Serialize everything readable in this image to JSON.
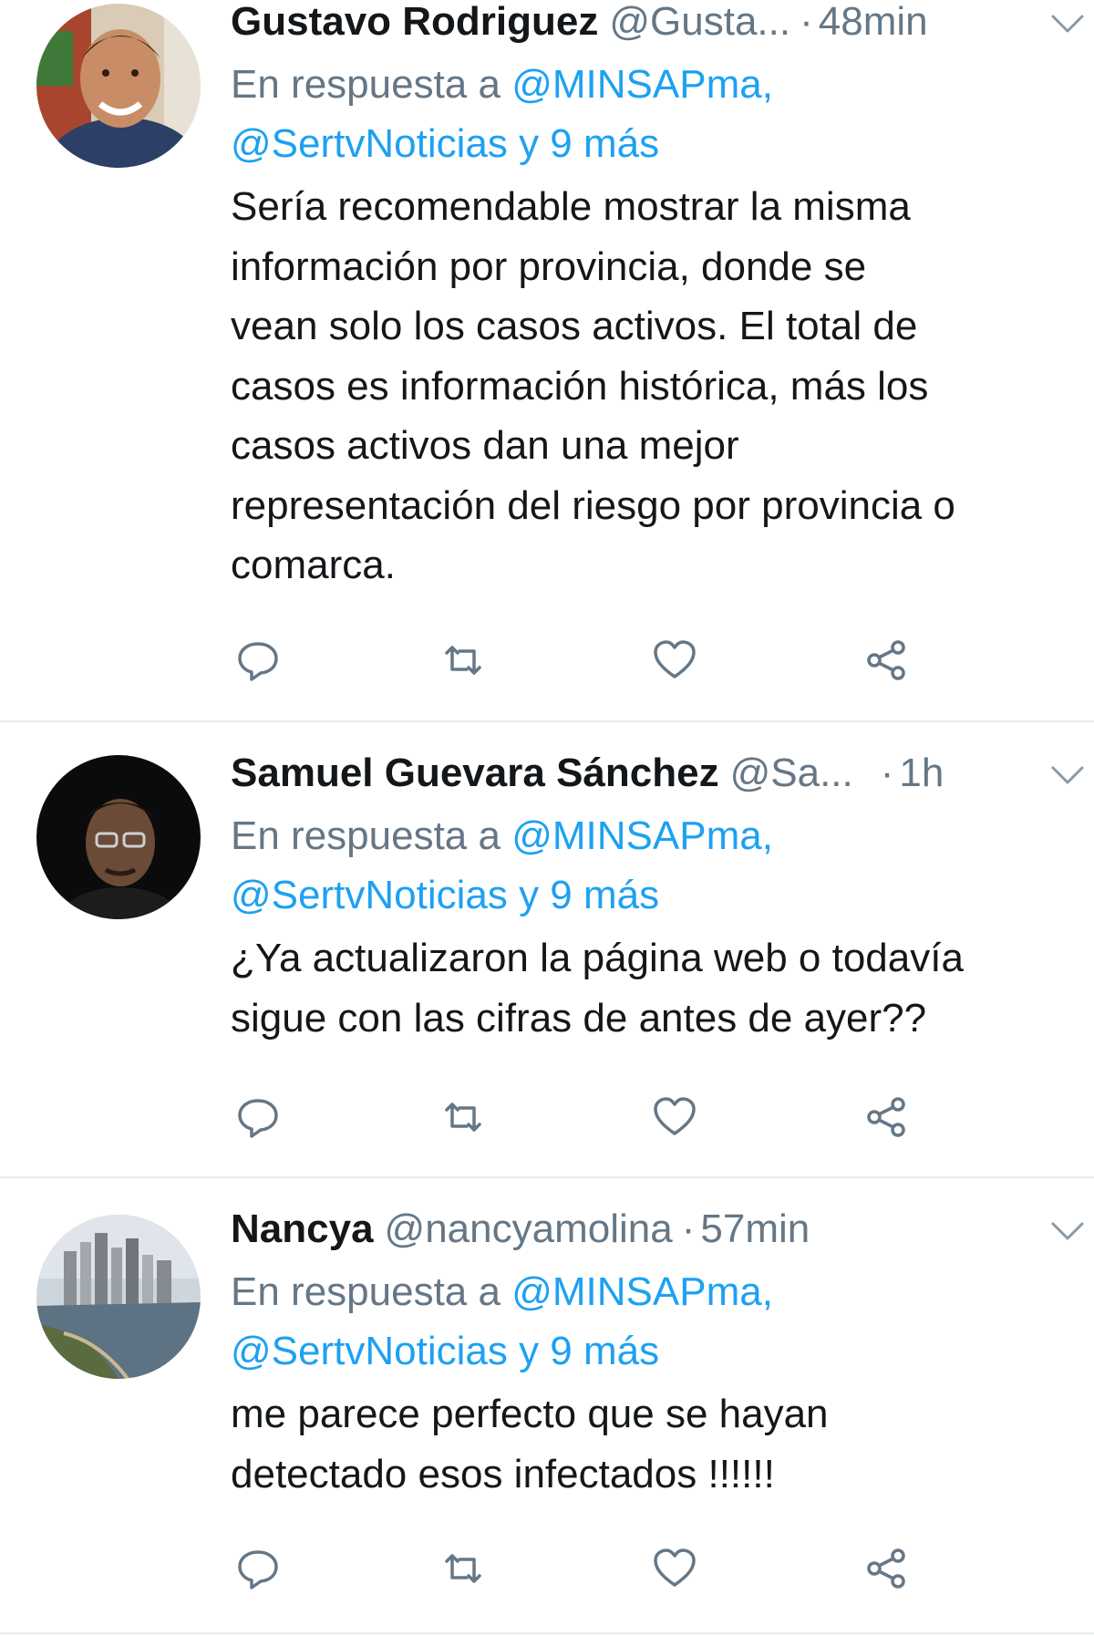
{
  "tweets": [
    {
      "name": "Gustavo Rodriguez",
      "handle": "@Gusta...",
      "time": "48min",
      "reply_prefix": "En respuesta a",
      "reply_mention_1": "@MINSAPma,",
      "reply_mention_2": "@SertvNoticias y 9 más",
      "lines": [
        "Sería recomendable mostrar la misma",
        "información por provincia, donde se",
        "vean solo los casos activos. El total de",
        "casos es información histórica, más los",
        "casos activos dan una mejor",
        "representación del riesgo por provincia o",
        "comarca."
      ]
    },
    {
      "name": "Samuel Guevara Sánchez",
      "handle": "@Sa...",
      "time": "1h",
      "reply_prefix": "En respuesta a",
      "reply_mention_1": "@MINSAPma,",
      "reply_mention_2": "@SertvNoticias y 9 más",
      "lines": [
        "¿Ya actualizaron la página web o todavía",
        "sigue con las cifras de antes de ayer??"
      ]
    },
    {
      "name": "Nancya",
      "handle": "@nancyamolina",
      "time": "57min",
      "reply_prefix": "En respuesta a",
      "reply_mention_1": "@MINSAPma,",
      "reply_mention_2": "@SertvNoticias y 9 más",
      "lines": [
        "me parece perfecto que se hayan",
        "detectado esos infectados !!!!!!"
      ]
    }
  ],
  "icons": {
    "reply": "reply-icon",
    "retweet": "retweet-icon",
    "like": "heart-icon",
    "share": "share-icon",
    "menu": "chevron-down-icon"
  },
  "colors": {
    "text": "#14171a",
    "secondary": "#657786",
    "mention": "#1da1f2",
    "divider": "#e6ecf0"
  }
}
